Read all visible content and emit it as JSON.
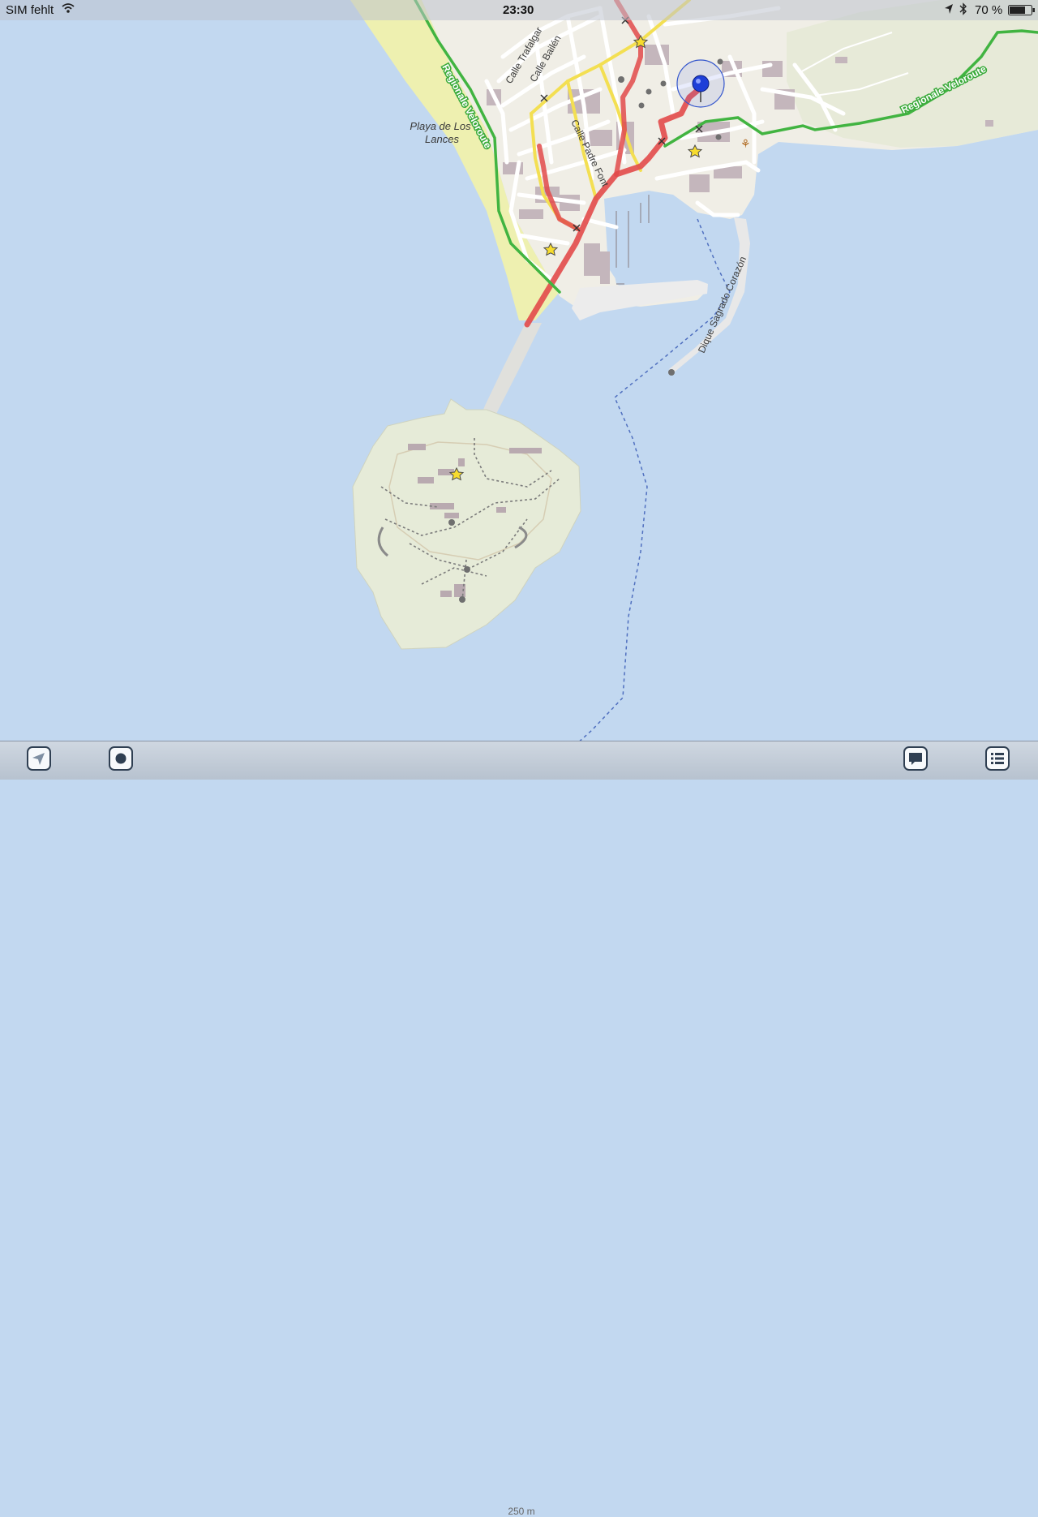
{
  "status_bar": {
    "carrier": "SIM fehlt",
    "time": "23:30",
    "battery": "70 %"
  },
  "map": {
    "labels": {
      "beach": [
        "Playa de Los",
        "Lances"
      ],
      "street_trafalgar": "Calle Trafalgar",
      "street_bailen": "Calle Bailén",
      "street_padre_font": "Calle Padre Font",
      "pier": "Dique Sagrado Corazón",
      "veloroute_west": "Regionale Veloroute",
      "veloroute_east": "Regionale Veloroute"
    },
    "colors": {
      "sea": "#c2d8f0",
      "land": "#f0eee6",
      "island": "#e6ebd8",
      "beach": "#eef0b0",
      "route_red": "#e24a4a",
      "road_yellow": "#f3df52",
      "cycle_green": "#41b441",
      "location_blue": "#1f3fd8"
    }
  },
  "scale": {
    "label": "250 m"
  },
  "toolbar": {
    "left_icons": [
      "location-arrow-icon",
      "record-icon"
    ],
    "right_icons": [
      "comment-icon",
      "list-icon"
    ]
  }
}
